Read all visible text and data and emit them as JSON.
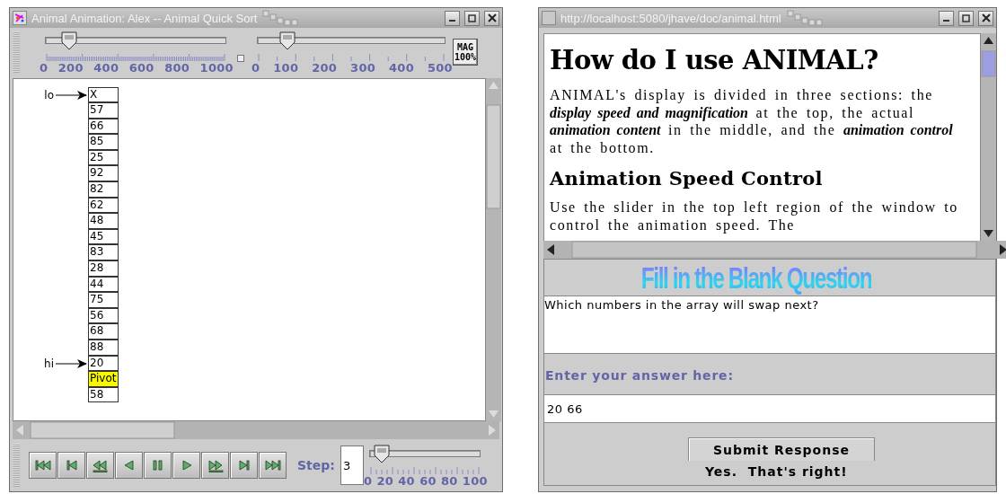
{
  "animation_window": {
    "title": "Animal Animation: Alex -- Animal Quick Sort",
    "speed_slider": {
      "level": 0.1,
      "tick_labels": [
        "0",
        "200",
        "400",
        "600",
        "800",
        "1000"
      ]
    },
    "zoom_slider": {
      "level": 0.13,
      "tick_labels": [
        "0",
        "100",
        "200",
        "300",
        "400",
        "500"
      ]
    },
    "mag_button": {
      "lines": [
        "MAG",
        "100%"
      ]
    },
    "array": [
      {
        "text": "X",
        "pointer": "lo",
        "highlighted": false
      },
      {
        "text": "57",
        "highlighted": false
      },
      {
        "text": "66",
        "highlighted": false
      },
      {
        "text": "85",
        "highlighted": false
      },
      {
        "text": "25",
        "highlighted": false
      },
      {
        "text": "92",
        "highlighted": false
      },
      {
        "text": "82",
        "highlighted": false
      },
      {
        "text": "62",
        "highlighted": false
      },
      {
        "text": "48",
        "highlighted": false
      },
      {
        "text": "45",
        "highlighted": false
      },
      {
        "text": "83",
        "highlighted": false
      },
      {
        "text": "28",
        "highlighted": false
      },
      {
        "text": "44",
        "highlighted": false
      },
      {
        "text": "75",
        "highlighted": false
      },
      {
        "text": "56",
        "highlighted": false
      },
      {
        "text": "68",
        "highlighted": false
      },
      {
        "text": "88",
        "highlighted": false
      },
      {
        "text": "20",
        "pointer": "hi",
        "highlighted": false
      },
      {
        "text": "Pivot",
        "highlighted": true
      },
      {
        "text": "58",
        "highlighted": false
      }
    ],
    "step_label": "Step:",
    "step_value": "3",
    "step_slider": {
      "level": 0.05,
      "tick_labels": [
        "0",
        "20",
        "40",
        "60",
        "80",
        "100"
      ]
    }
  },
  "question_window": {
    "title": "http://localhost:5080/jhave/doc/animal.html",
    "doc_heading": "How do I use ANIMAL?",
    "doc_paragraph": "ANIMAL's display is divided in three sections: the **display speed and magnification** at the top, the actual **animation content** in the middle, and the **animation control** at the bottom.",
    "doc_subheading": "Animation Speed Control",
    "doc_paragraph_2": "Use the slider in the top left region of the window to control the animation speed. The",
    "question_title": "Fill in the Blank Question",
    "question_text": "Which numbers in the array will swap next?",
    "answer_label": "Enter your answer here:",
    "answer_value": "20 66",
    "submit_button": "Submit Response",
    "feedback": "Yes.  That's right!"
  }
}
